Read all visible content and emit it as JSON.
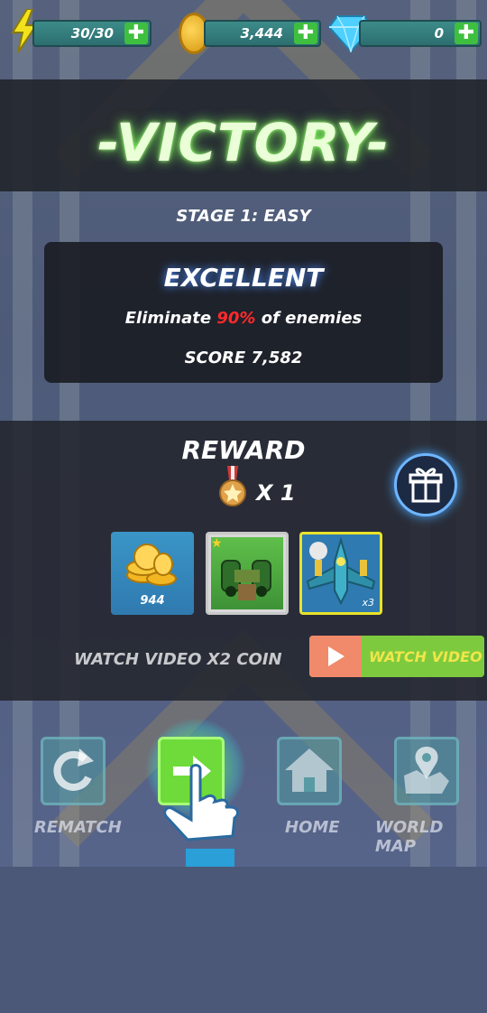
{
  "resources": {
    "energy": "30/30",
    "coins": "3,444",
    "gems": "0",
    "plus_symbol": "✚"
  },
  "result": {
    "title": "-VICTORY-",
    "stage": "STAGE  1: EASY",
    "rating": "EXCELLENT",
    "eliminate_prefix": "Eliminate ",
    "eliminate_pct": "90%",
    "eliminate_suffix": " of enemies",
    "score": "SCORE 7,582"
  },
  "reward": {
    "title": "REWARD",
    "medal_count": "X 1",
    "items": [
      {
        "name": "coins",
        "count": "944"
      },
      {
        "name": "cannon"
      },
      {
        "name": "ship",
        "multiplier": "x3"
      }
    ]
  },
  "watch": {
    "prompt": "WATCH VIDEO X2 COIN",
    "button_label": "WATCH VIDEO"
  },
  "nav": {
    "rematch": "REMATCH",
    "home": "HOME",
    "world_map": "WORLD MAP"
  },
  "colors": {
    "victory_glow": "#7fff5a",
    "percent_red": "#ff2a2a",
    "watch_green": "#7eca3e",
    "watch_play": "#f08a6a"
  }
}
